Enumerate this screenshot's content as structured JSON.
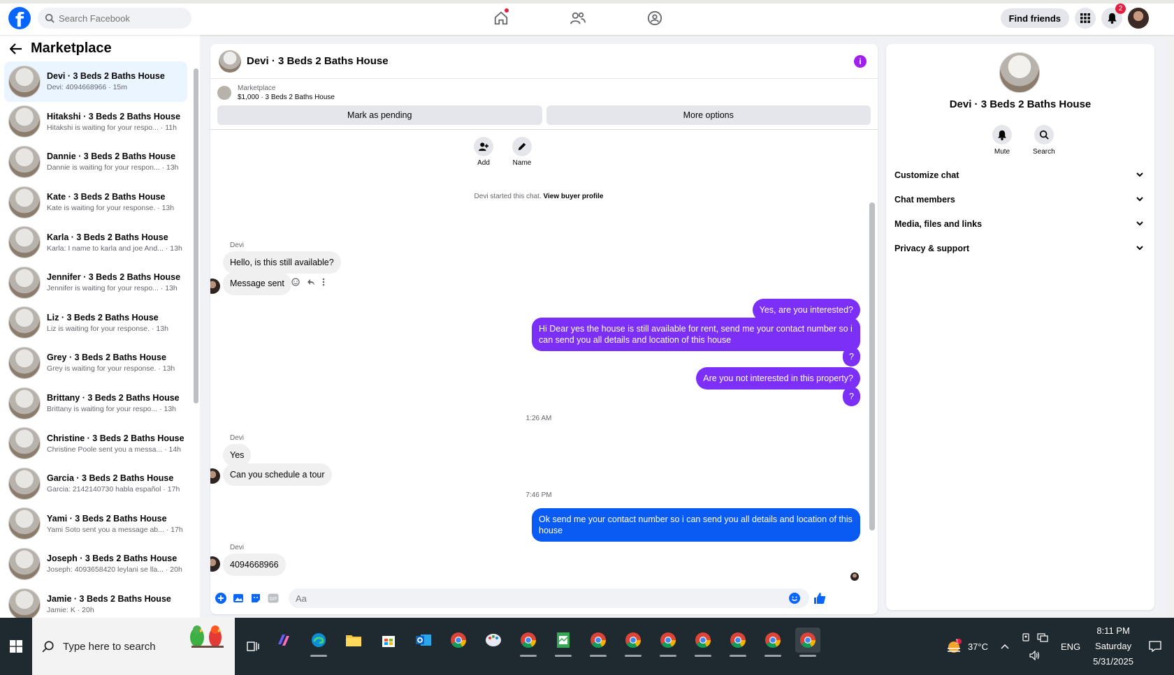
{
  "topbar": {
    "logo": "f",
    "search_placeholder": "Search Facebook",
    "find_friends": "Find friends",
    "notification_count": "2"
  },
  "sidebar": {
    "title": "Marketplace",
    "conversations": [
      {
        "name": "Devi · 3 Beds 2 Baths House",
        "preview": "Devi: 4094668966 · 15m"
      },
      {
        "name": "Hitakshi · 3 Beds 2 Baths House",
        "preview": "Hitakshi is waiting for your respo... · 11h"
      },
      {
        "name": "Dannie · 3 Beds 2 Baths House",
        "preview": "Dannie is waiting for your respon... · 13h"
      },
      {
        "name": "Kate · 3 Beds 2 Baths House",
        "preview": "Kate is waiting for your response. · 13h"
      },
      {
        "name": "Karla · 3 Beds 2 Baths House",
        "preview": "Karla: I name to karla and joe And... · 13h"
      },
      {
        "name": "Jennifer · 3 Beds 2 Baths House",
        "preview": "Jennifer is waiting for your respo... · 13h"
      },
      {
        "name": "Liz · 3 Beds 2 Baths House",
        "preview": "Liz is waiting for your response. · 13h"
      },
      {
        "name": "Grey · 3 Beds 2 Baths House",
        "preview": "Grey is waiting for your response. · 13h"
      },
      {
        "name": "Brittany · 3 Beds 2 Baths House",
        "preview": "Brittany is waiting for your respo... · 13h"
      },
      {
        "name": "Christine · 3 Beds 2 Baths House",
        "preview": "Christine Poole sent you a messa... · 14h"
      },
      {
        "name": "Garcia · 3 Beds 2 Baths House",
        "preview": "Garcia: 2142140730 habla español · 17h"
      },
      {
        "name": "Yami · 3 Beds 2 Baths House",
        "preview": "Yami Soto sent you a message ab... · 17h"
      },
      {
        "name": "Joseph · 3 Beds 2 Baths House",
        "preview": "Joseph: 4093658420 leylani se lla... · 20h"
      },
      {
        "name": "Jamie · 3 Beds 2 Baths House",
        "preview": "Jamie: K · 20h"
      }
    ]
  },
  "chat": {
    "title": "Devi · 3 Beds 2 Baths House",
    "listing_label": "Marketplace",
    "listing_price": "$1,000 · 3 Beds 2 Baths House",
    "mark_pending": "Mark as pending",
    "more_options": "More options",
    "add_label": "Add",
    "name_label": "Name",
    "started_text": "Devi started this chat.",
    "view_profile": "View buyer profile",
    "sender": "Devi",
    "msg1": "Hello, is this still available?",
    "msg2": "Message sent",
    "out1": "Yes, are you interested?",
    "out2": "Hi Dear yes the house is still available for rent, send me your contact number so i can send you all details and location of this house",
    "out3": "?",
    "out4": "Are you not interested in this property?",
    "out5": "?",
    "ts1": "1:26 AM",
    "msg3": "Yes",
    "msg4": "Can you schedule a tour",
    "ts2": "7:46 PM",
    "out6": "Ok  send me your contact number so i can send you all details and location of this house",
    "msg5": "4094668966",
    "composer_placeholder": "Aa"
  },
  "info": {
    "title": "Devi · 3 Beds 2 Baths House",
    "mute": "Mute",
    "search": "Search",
    "rows": [
      "Customize chat",
      "Chat members",
      "Media, files and links",
      "Privacy & support"
    ]
  },
  "taskbar": {
    "search_placeholder": "Type here to search",
    "weather": "37°C",
    "weather_badge": "1",
    "lang": "ENG",
    "time": "8:11 PM",
    "day": "Saturday",
    "date": "5/31/2025"
  },
  "colors": {
    "brand": "#0866ff",
    "outgoing": "#7b2ff7",
    "outgoing_blue": "#0a5bf4",
    "taskbar": "#1f2a30"
  }
}
